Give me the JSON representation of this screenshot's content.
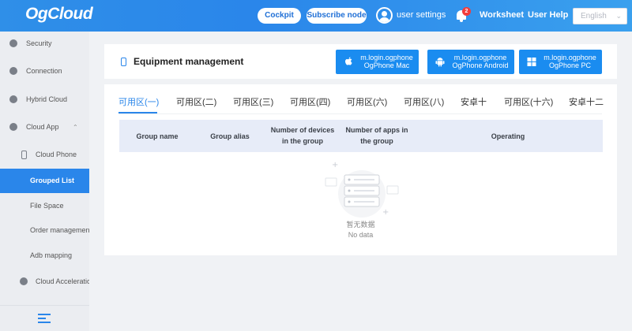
{
  "header": {
    "logo": "OgCloud",
    "cockpit_label": "Cockpit",
    "subscribe_label": "Subscribe node",
    "user_settings_label": "user settings",
    "notification_count": "2",
    "worksheet_label": "Worksheet",
    "user_help_label": "User Help",
    "language_select": {
      "value": "English"
    }
  },
  "sidebar": {
    "items": [
      {
        "label": "Security",
        "icon": "shield-icon"
      },
      {
        "label": "Connection",
        "icon": "connection-icon"
      },
      {
        "label": "Hybrid Cloud",
        "icon": "cloud-icon"
      },
      {
        "label": "Cloud App",
        "icon": "app-icon",
        "expanded": true
      },
      {
        "label": "Cloud Phone",
        "icon": "phone-icon",
        "expanded": true
      },
      {
        "label": "Grouped List",
        "active": true
      },
      {
        "label": "File Space"
      },
      {
        "label": "Order management"
      },
      {
        "label": "Adb mapping"
      },
      {
        "label": "Cloud Acceleration",
        "icon": "acceleration-icon"
      }
    ]
  },
  "page": {
    "title": "Equipment management",
    "downloads": [
      {
        "line1": "m.login.ogphone",
        "line2": "OgPhone Mac",
        "icon": "apple-icon"
      },
      {
        "line1": "m.login.ogphone",
        "line2": "OgPhone Android",
        "icon": "android-icon"
      },
      {
        "line1": "m.login.ogphone",
        "line2": "OgPhone PC",
        "icon": "windows-icon"
      }
    ],
    "tabs": [
      "可用区(一)",
      "可用区(二)",
      "可用区(三)",
      "可用区(四)",
      "可用区(六)",
      "可用区(八)",
      "安卓十",
      "可用区(十六)",
      "安卓十二"
    ],
    "active_tab": 0,
    "table": {
      "columns": [
        "Group name",
        "Group alias",
        "Number of devices in the group",
        "Number of apps in the group",
        "Operating"
      ],
      "col_lines": [
        [
          "Group name"
        ],
        [
          "Group alias"
        ],
        [
          "Number of devices",
          "in the group"
        ],
        [
          "Number of apps in",
          "the group"
        ],
        [
          "Operating"
        ]
      ]
    },
    "empty": {
      "text_cn": "暂无数据",
      "text_en": "No data"
    }
  },
  "colors": {
    "accent": "#2a86ea",
    "badge": "#f23c3c",
    "header_bg": "#e7ecf8"
  }
}
